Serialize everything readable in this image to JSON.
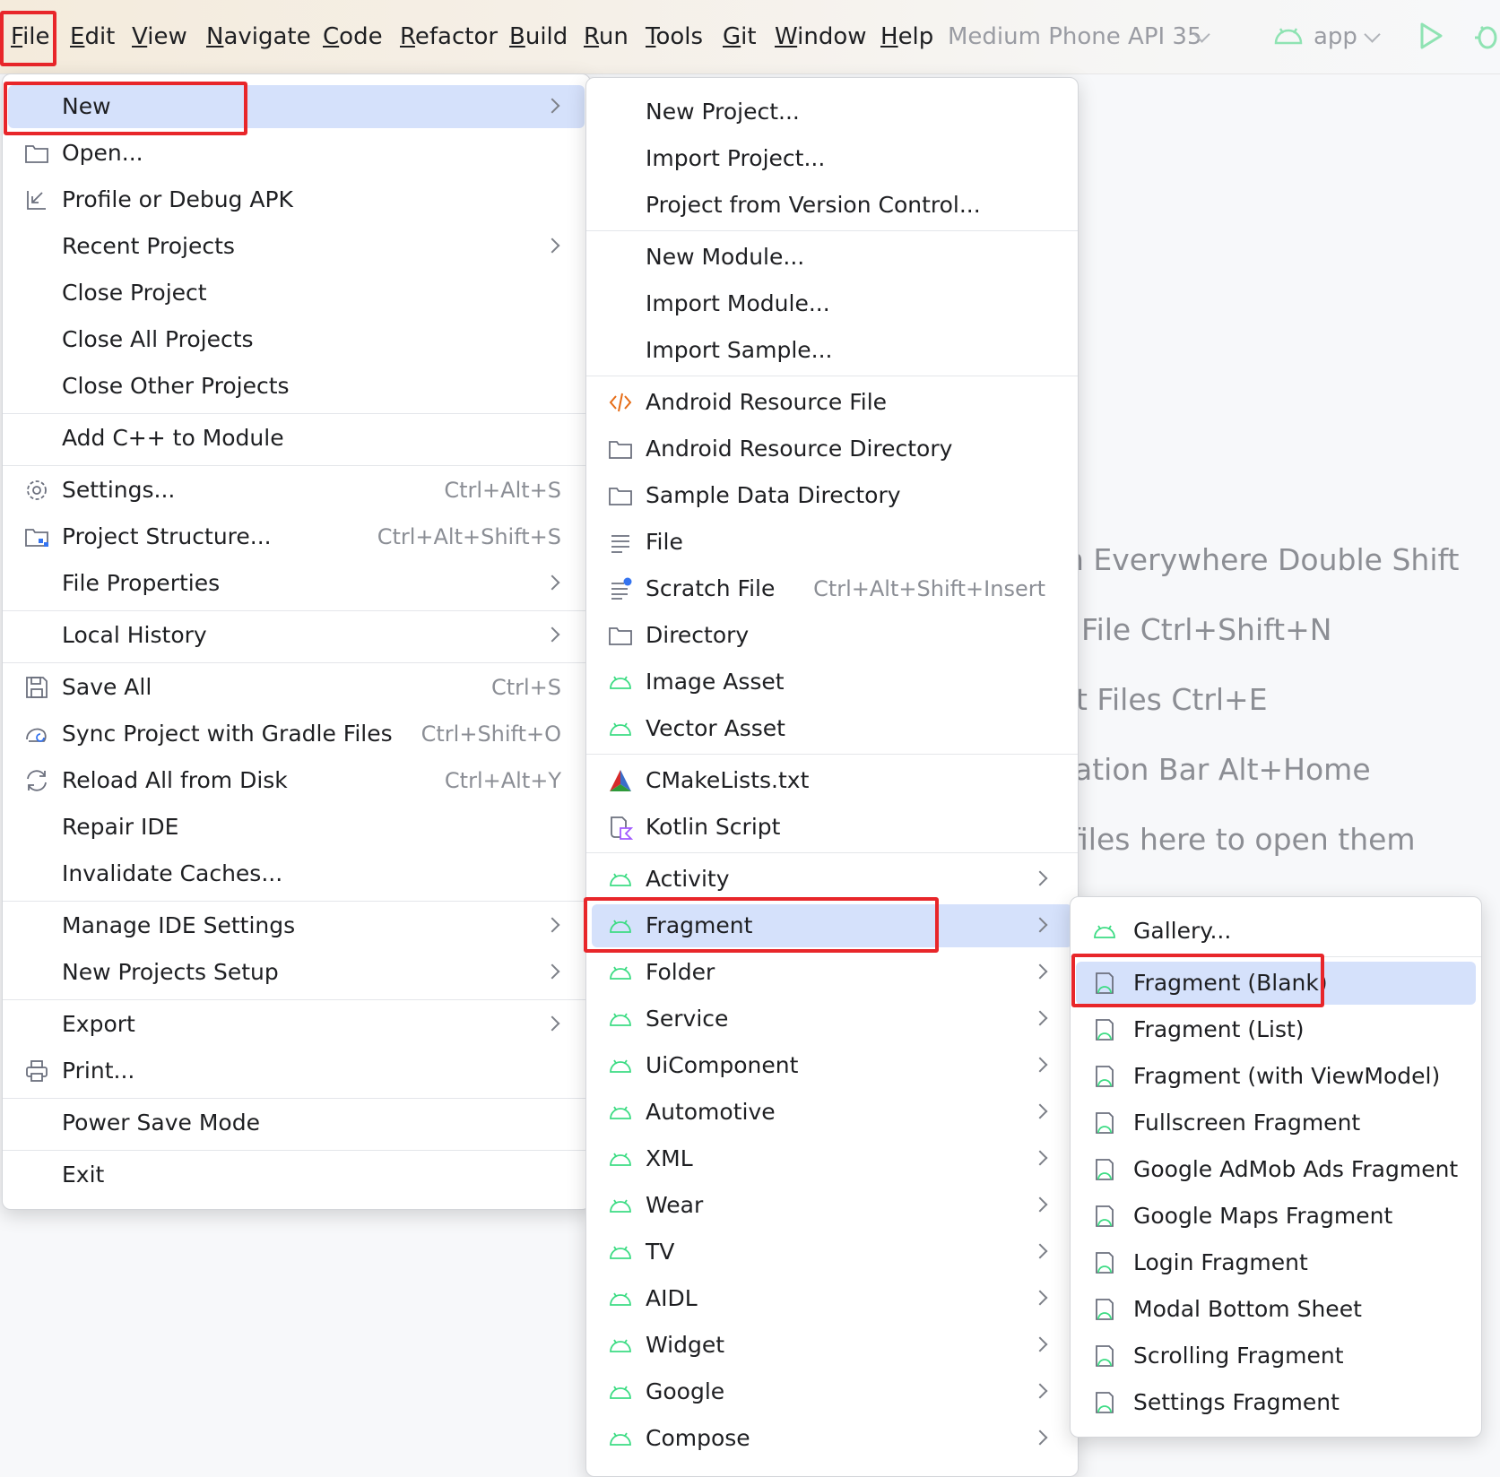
{
  "menubar": {
    "items": [
      "File",
      "Edit",
      "View",
      "Navigate",
      "Code",
      "Refactor",
      "Build",
      "Run",
      "Tools",
      "Git",
      "Window",
      "Help"
    ],
    "device": "Medium Phone API 35",
    "config": "app"
  },
  "background_hints": [
    "n Everywhere Double Shift",
    "File Ctrl+Shift+N",
    "t Files Ctrl+E",
    "ation Bar Alt+Home",
    "files here to open them"
  ],
  "file_menu": {
    "items": [
      {
        "label": "New",
        "shortcut": ""
      },
      {
        "label": "Open...",
        "shortcut": ""
      },
      {
        "label": "Profile or Debug APK",
        "shortcut": ""
      },
      {
        "label": "Recent Projects",
        "shortcut": ""
      },
      {
        "label": "Close Project",
        "shortcut": ""
      },
      {
        "label": "Close All Projects",
        "shortcut": ""
      },
      {
        "label": "Close Other Projects",
        "shortcut": ""
      },
      {
        "label": "Add C++ to Module",
        "shortcut": ""
      },
      {
        "label": "Settings...",
        "shortcut": "Ctrl+Alt+S"
      },
      {
        "label": "Project Structure...",
        "shortcut": "Ctrl+Alt+Shift+S"
      },
      {
        "label": "File Properties",
        "shortcut": ""
      },
      {
        "label": "Local History",
        "shortcut": ""
      },
      {
        "label": "Save All",
        "shortcut": "Ctrl+S"
      },
      {
        "label": "Sync Project with Gradle Files",
        "shortcut": "Ctrl+Shift+O"
      },
      {
        "label": "Reload All from Disk",
        "shortcut": "Ctrl+Alt+Y"
      },
      {
        "label": "Repair IDE",
        "shortcut": ""
      },
      {
        "label": "Invalidate Caches...",
        "shortcut": ""
      },
      {
        "label": "Manage IDE Settings",
        "shortcut": ""
      },
      {
        "label": "New Projects Setup",
        "shortcut": ""
      },
      {
        "label": "Export",
        "shortcut": ""
      },
      {
        "label": "Print...",
        "shortcut": ""
      },
      {
        "label": "Power Save Mode",
        "shortcut": ""
      },
      {
        "label": "Exit",
        "shortcut": ""
      }
    ]
  },
  "new_menu": {
    "items": [
      {
        "label": "New Project...",
        "shortcut": ""
      },
      {
        "label": "Import Project...",
        "shortcut": ""
      },
      {
        "label": "Project from Version Control...",
        "shortcut": ""
      },
      {
        "label": "New Module...",
        "shortcut": ""
      },
      {
        "label": "Import Module...",
        "shortcut": ""
      },
      {
        "label": "Import Sample...",
        "shortcut": ""
      },
      {
        "label": "Android Resource File",
        "shortcut": ""
      },
      {
        "label": "Android Resource Directory",
        "shortcut": ""
      },
      {
        "label": "Sample Data Directory",
        "shortcut": ""
      },
      {
        "label": "File",
        "shortcut": ""
      },
      {
        "label": "Scratch File",
        "shortcut": "Ctrl+Alt+Shift+Insert"
      },
      {
        "label": "Directory",
        "shortcut": ""
      },
      {
        "label": "Image Asset",
        "shortcut": ""
      },
      {
        "label": "Vector Asset",
        "shortcut": ""
      },
      {
        "label": "CMakeLists.txt",
        "shortcut": ""
      },
      {
        "label": "Kotlin Script",
        "shortcut": ""
      },
      {
        "label": "Activity",
        "shortcut": ""
      },
      {
        "label": "Fragment",
        "shortcut": ""
      },
      {
        "label": "Folder",
        "shortcut": ""
      },
      {
        "label": "Service",
        "shortcut": ""
      },
      {
        "label": "UiComponent",
        "shortcut": ""
      },
      {
        "label": "Automotive",
        "shortcut": ""
      },
      {
        "label": "XML",
        "shortcut": ""
      },
      {
        "label": "Wear",
        "shortcut": ""
      },
      {
        "label": "TV",
        "shortcut": ""
      },
      {
        "label": "AIDL",
        "shortcut": ""
      },
      {
        "label": "Widget",
        "shortcut": ""
      },
      {
        "label": "Google",
        "shortcut": ""
      },
      {
        "label": "Compose",
        "shortcut": ""
      }
    ]
  },
  "fragment_menu": {
    "items": [
      {
        "label": "Gallery..."
      },
      {
        "label": "Fragment (Blank)"
      },
      {
        "label": "Fragment (List)"
      },
      {
        "label": "Fragment (with ViewModel)"
      },
      {
        "label": "Fullscreen Fragment"
      },
      {
        "label": "Google AdMob Ads Fragment"
      },
      {
        "label": "Google Maps Fragment"
      },
      {
        "label": "Login Fragment"
      },
      {
        "label": "Modal Bottom Sheet"
      },
      {
        "label": "Scrolling Fragment"
      },
      {
        "label": "Settings Fragment"
      }
    ]
  },
  "colors": {
    "highlight": "#e8262a",
    "selection": "#d5e1fb",
    "android_green": "#3ddc84"
  }
}
